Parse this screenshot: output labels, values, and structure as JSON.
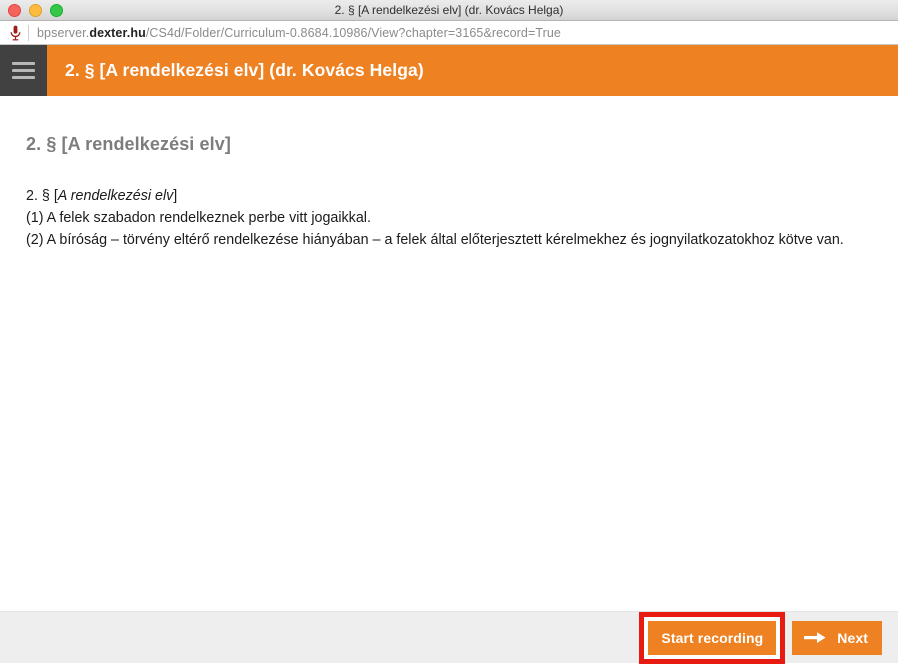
{
  "window": {
    "title": "2. § [A rendelkezési elv] (dr. Kovács Helga)",
    "traffic_lights": [
      "close",
      "minimize",
      "zoom"
    ]
  },
  "urlbar": {
    "mic_icon": "microphone-icon",
    "url_prefix": "bpserver.",
    "url_host": "dexter.hu",
    "url_suffix": "/CS4d/Folder/Curriculum-0.8684.10986/View?chapter=3165&record=True",
    "full_url": "bpserver.dexter.hu/CS4d/Folder/Curriculum-0.8684.10986/View?chapter=3165&record=True"
  },
  "appbar": {
    "menu_icon": "hamburger-menu-icon",
    "title": "2. § [A rendelkezési elv] (dr. Kovács Helga)",
    "background_color": "#ee8121",
    "menu_background_color": "#414141"
  },
  "content": {
    "heading": "2. § [A rendelkezési elv]",
    "paragraphs": [
      {
        "prefix": "2. § [",
        "emphasis": "A rendelkezési elv",
        "suffix": "]"
      },
      {
        "text": "(1) A felek szabadon rendelkeznek perbe vitt jogaikkal."
      },
      {
        "text": "(2) A bíróság – törvény eltérő rendelkezése hiányában – a felek által előterjesztett kérelmekhez és jognyilatkozatokhoz kötve van."
      }
    ]
  },
  "bottombar": {
    "record_button_label": "Start recording",
    "next_button_label": "Next",
    "next_icon": "arrow-right-icon",
    "highlight_color": "#e81b12",
    "button_color": "#ee8121"
  }
}
